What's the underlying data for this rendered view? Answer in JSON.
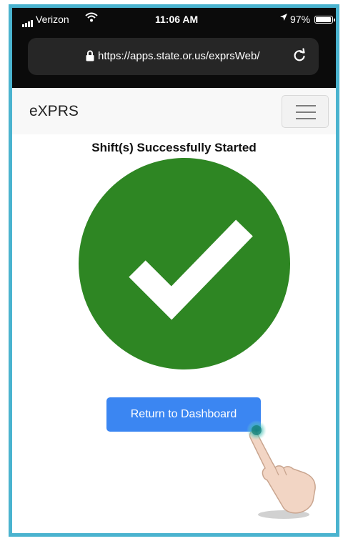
{
  "status_bar": {
    "carrier": "Verizon",
    "time": "11:06 AM",
    "battery_percent": "97%",
    "signal_icon": "signal-bars-icon",
    "wifi_icon": "wifi-icon",
    "location_icon": "location-arrow-icon",
    "battery_icon": "battery-icon"
  },
  "browser": {
    "url": "https://apps.state.or.us/exprsWeb/",
    "lock_icon": "lock-icon",
    "reload_icon": "reload-icon"
  },
  "navbar": {
    "brand": "eXPRS",
    "menu_icon": "hamburger-menu-icon"
  },
  "main": {
    "heading": "Shift(s) Successfully Started",
    "status_icon": "checkmark-circle-icon",
    "return_button_label": "Return to Dashboard"
  },
  "colors": {
    "frame_border": "#4ab3cf",
    "success_green": "#2e8623",
    "button_blue": "#3b86f2",
    "navbar_bg": "#f8f8f8"
  }
}
